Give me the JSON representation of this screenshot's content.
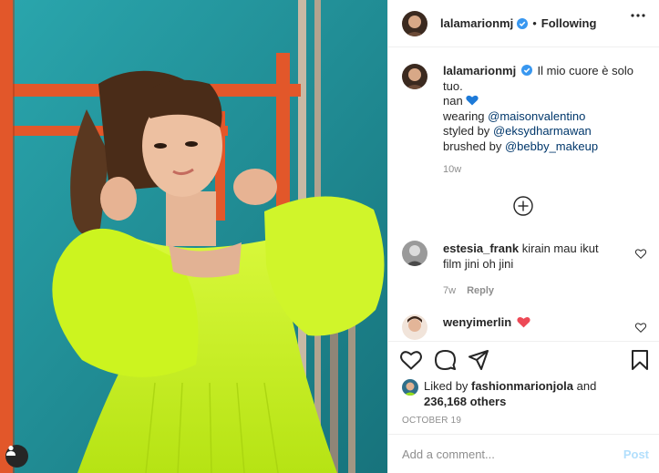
{
  "colors": {
    "verified": "#3897f0",
    "link": "#00376b",
    "muted": "#8e8e8e",
    "post_disabled": "#b2dffc",
    "heart_red": "#ed4956",
    "heart_blue": "#1d7ad8",
    "dress_green": "#c8f21a",
    "wall_teal": "#1f8f98",
    "scaffold_orange": "#e2572a"
  },
  "media": {
    "tag_icon": "user-icon"
  },
  "header": {
    "username": "lalamarionmj",
    "separator": "•",
    "follow_label": "Following",
    "more_icon": "ellipsis-icon"
  },
  "caption": {
    "username": "lalamarionmj",
    "line1": "Il mio cuore è solo tuo.",
    "line2_prefix": "nan",
    "wearing_label": "wearing",
    "wearing_handle": "@maisonvalentino",
    "styled_label": "styled by",
    "styled_handle": "@eksydharmawan",
    "brushed_label": "brushed by",
    "brushed_handle": "@bebby_makeup",
    "age": "10w"
  },
  "comments": [
    {
      "username": "estesia_frank",
      "text": "kirain mau ikut film jini oh jini",
      "age": "7w",
      "reply_label": "Reply"
    },
    {
      "username": "wenyimerlin",
      "text": ""
    }
  ],
  "load_more_icon": "plus-circle-icon",
  "actions": {
    "icons": [
      "heart-icon",
      "comment-icon",
      "share-icon",
      "bookmark-icon"
    ]
  },
  "likes": {
    "prefix": "Liked by",
    "user": "fashionmarionjola",
    "conj": "and",
    "count": "236,168 others"
  },
  "date": "OCTOBER 19",
  "add_comment": {
    "placeholder": "Add a comment...",
    "post_label": "Post"
  }
}
